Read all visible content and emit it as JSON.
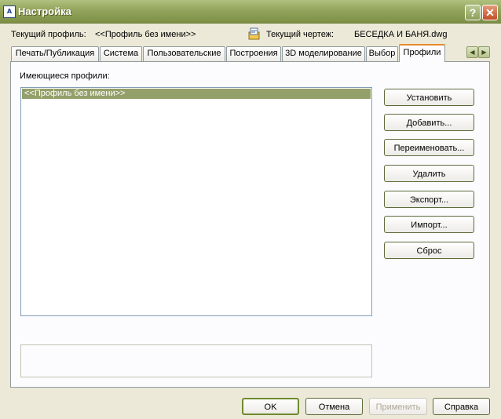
{
  "window": {
    "title": "Настройка"
  },
  "info": {
    "profile_label": "Текущий профиль:",
    "profile_value": "<<Профиль без имени>>",
    "drawing_label": "Текущий чертеж:",
    "drawing_value": "БЕСЕДКА И БАНЯ.dwg"
  },
  "tabs": [
    {
      "label": "Печать/Публикация"
    },
    {
      "label": "Система"
    },
    {
      "label": "Пользовательские"
    },
    {
      "label": "Построения"
    },
    {
      "label": "3D моделирование"
    },
    {
      "label": "Выбор"
    },
    {
      "label": "Профили",
      "active": true
    }
  ],
  "profiles": {
    "list_label": "Имеющиеся профили:",
    "items": [
      {
        "label": "<<Профиль без имени>>",
        "selected": true
      }
    ],
    "buttons": {
      "set": "Установить",
      "add": "Добавить...",
      "rename": "Переименовать...",
      "delete": "Удалить",
      "export": "Экспорт...",
      "import": "Импорт...",
      "reset": "Сброс"
    }
  },
  "footer": {
    "ok": "OK",
    "cancel": "Отмена",
    "apply": "Применить",
    "help": "Справка"
  }
}
